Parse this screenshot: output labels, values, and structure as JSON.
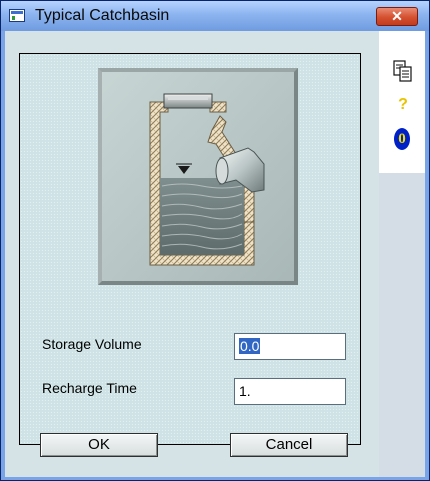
{
  "window": {
    "title": "Typical Catchbasin",
    "close_label": "✕",
    "app_icon": "window-app-icon"
  },
  "toolbar": {
    "items": [
      {
        "icon": "copy-icon"
      },
      {
        "icon": "help-icon",
        "glyph": "?"
      },
      {
        "icon": "info-icon",
        "glyph": "0"
      }
    ]
  },
  "form": {
    "storage_volume": {
      "label": "Storage Volume",
      "value": "0.0"
    },
    "recharge_time": {
      "label": "Recharge Time",
      "value": "1."
    }
  },
  "buttons": {
    "ok": "OK",
    "cancel": "Cancel"
  },
  "colors": {
    "title_bar": "#8cb4ef",
    "close_button": "#d4502f",
    "panel": "#cfe3e6",
    "selection": "#3166c5"
  }
}
